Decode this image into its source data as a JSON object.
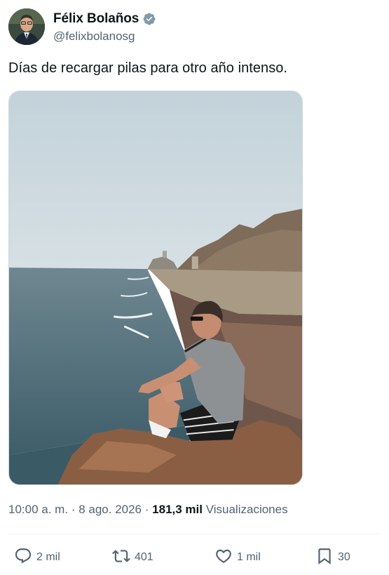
{
  "author": {
    "name": "Félix Bolaños",
    "handle": "@felixbolanosg",
    "verified": true,
    "verified_color": "#829aab"
  },
  "tweet": {
    "text": "Días de recargar pilas para otro año intenso."
  },
  "meta": {
    "time": "10:00 a. m.",
    "separator": "·",
    "date": "8 ago. 2026",
    "views_count": "181,3 mil",
    "views_label": "Visualizaciones"
  },
  "actions": {
    "replies": "2 mil",
    "reposts": "401",
    "likes": "1 mil",
    "bookmarks": "30"
  },
  "icons": {
    "reply": "reply-icon",
    "repost": "repost-icon",
    "like": "heart-icon",
    "bookmark": "bookmark-icon"
  }
}
